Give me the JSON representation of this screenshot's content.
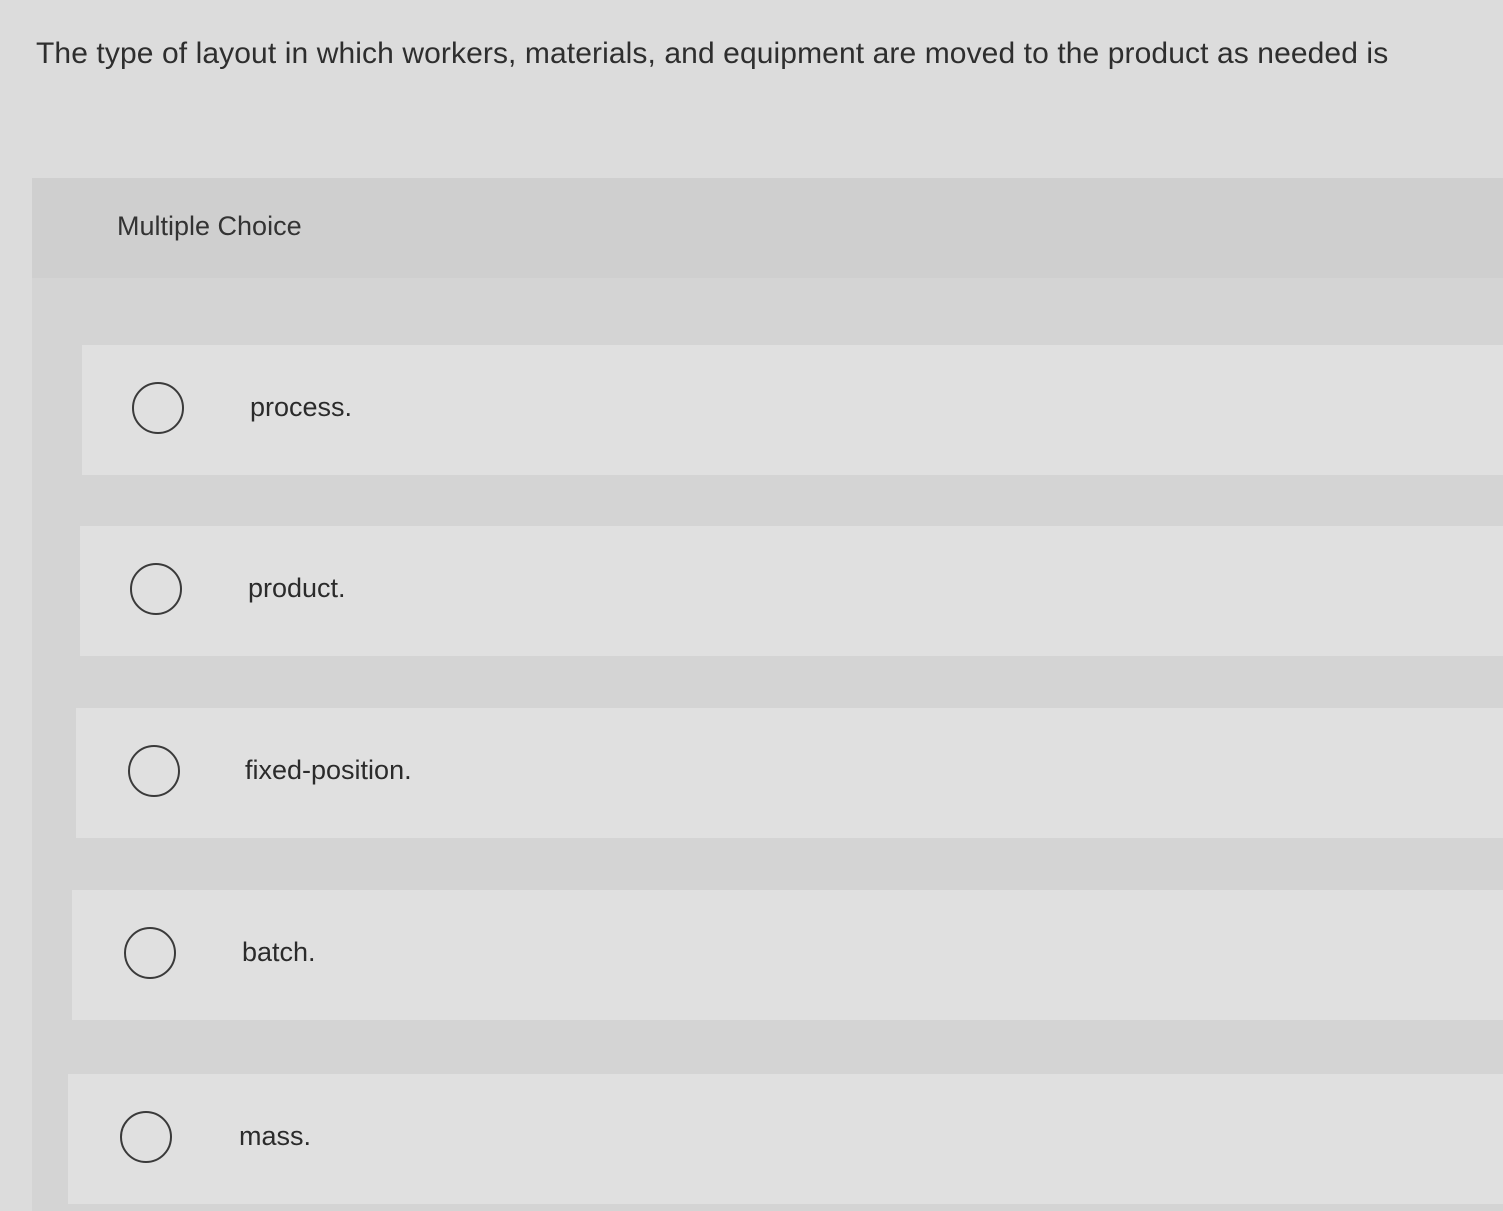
{
  "question": {
    "text": "The type of layout in which workers, materials, and equipment are moved to the product as needed is"
  },
  "multiple_choice": {
    "header": "Multiple Choice",
    "options": [
      {
        "label": "process."
      },
      {
        "label": "product."
      },
      {
        "label": "fixed-position."
      },
      {
        "label": "batch."
      },
      {
        "label": "mass."
      }
    ]
  }
}
